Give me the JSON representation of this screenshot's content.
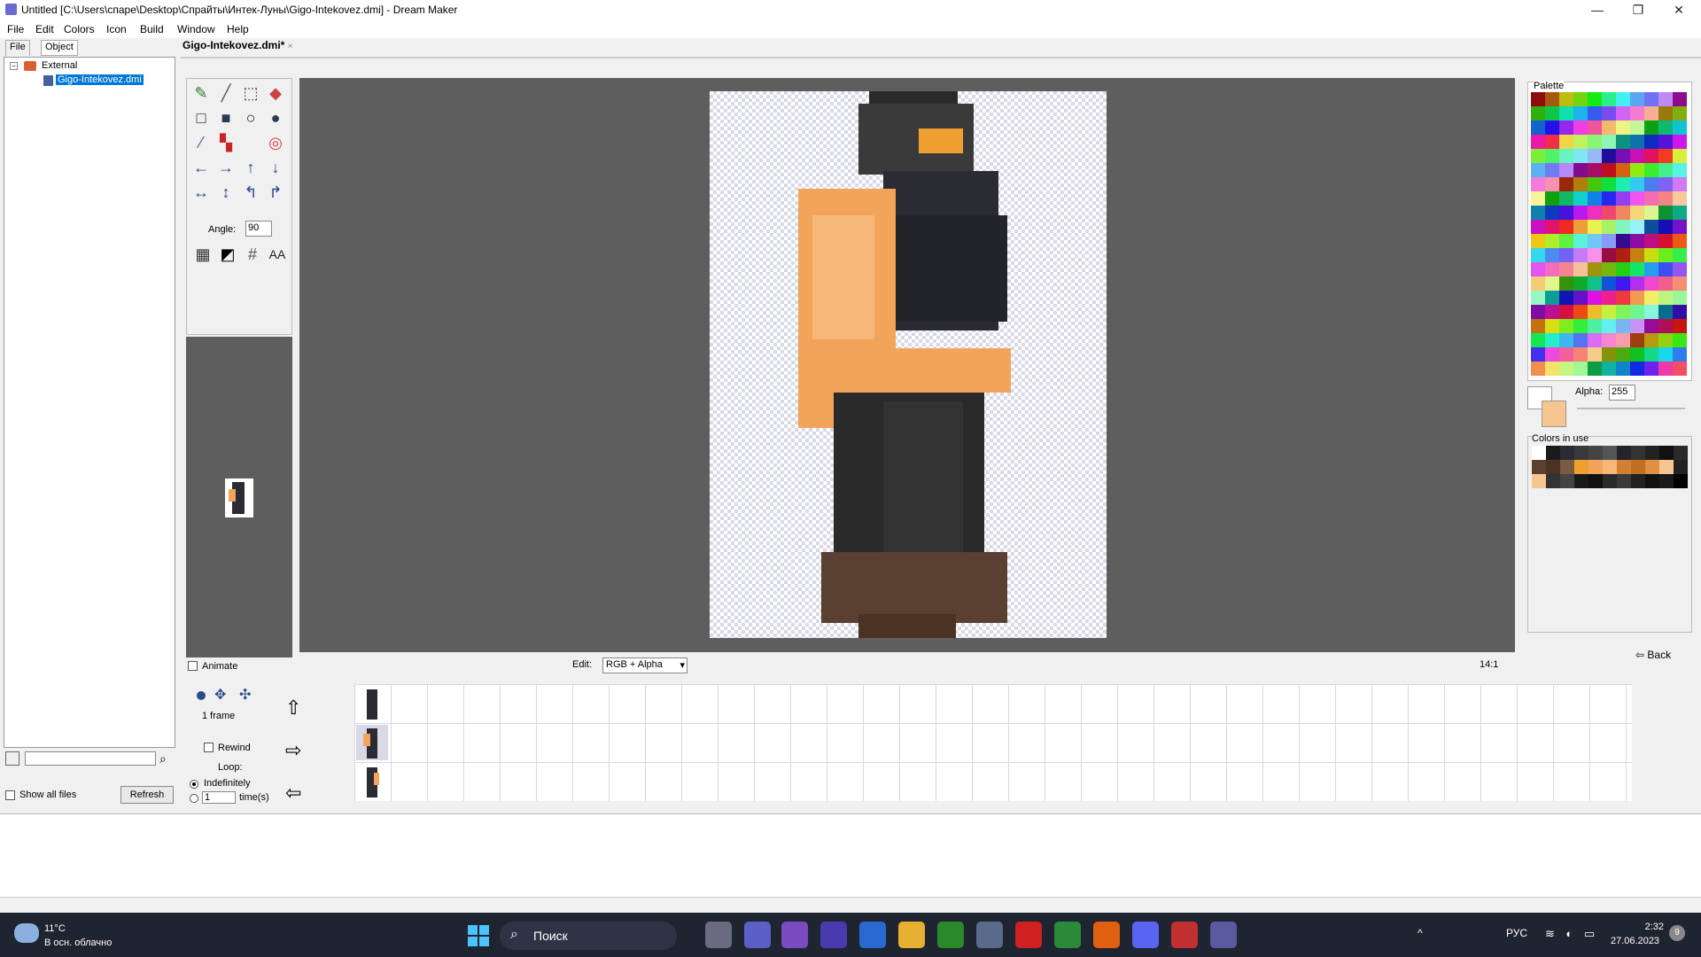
{
  "window": {
    "title": "Untitled [C:\\Users\\спаре\\Desktop\\Спрайты\\Интек-Луны\\Gigo-Intekovez.dmi] - Dream Maker",
    "minimize": "—",
    "maximize": "❐",
    "close": "✕"
  },
  "menu": [
    "File",
    "Edit",
    "Colors",
    "Icon",
    "Build",
    "Window",
    "Help"
  ],
  "left": {
    "tabs": [
      "File",
      "Object"
    ],
    "tree": {
      "root": "External",
      "child": "Gigo-Intekovez.dmi"
    },
    "show_all_files": "Show all files",
    "refresh": "Refresh"
  },
  "doc_tab": "Gigo-Intekovez.dmi*",
  "tools": {
    "angle_label": "Angle:",
    "angle_value": "90",
    "aa": "AA"
  },
  "animate_label": "Animate",
  "edit_label": "Edit:",
  "edit_mode": "RGB + Alpha",
  "zoom": "14:1",
  "right": {
    "palette_label": "Palette",
    "alpha_label": "Alpha:",
    "alpha_value": "255",
    "colors_in_use": "Colors in use",
    "back": "Back"
  },
  "anim": {
    "frames": "1 frame",
    "rewind": "Rewind",
    "loop": "Loop:",
    "indefinitely": "Indefinitely",
    "times_value": "1",
    "times_label": "time(s)"
  },
  "taskbar": {
    "temp": "11°C",
    "weather": "В осн. облачно",
    "search": "Поиск",
    "lang": "РУС",
    "time": "2:32",
    "date": "27.06.2023",
    "notif": "9"
  },
  "colors": {
    "accent": "#0078d7",
    "canvas_bg": "#5e5e5e",
    "skin": "#f2a55a",
    "armor": "#2b2b33",
    "boots": "#5a4030",
    "visor": "#f0a030"
  }
}
